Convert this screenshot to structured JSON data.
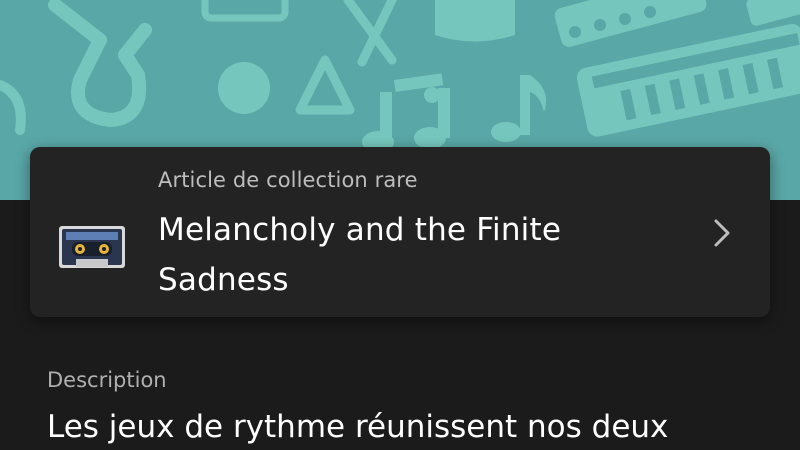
{
  "banner": {
    "pattern": "music-instruments-pattern",
    "color": "#5aa7a7"
  },
  "item_card": {
    "category": "Article de collection rare",
    "title": "Melancholy and the Finite Sadness",
    "thumbnail_icon": "cassette-tape-icon",
    "chevron_icon": "chevron-right-icon"
  },
  "description": {
    "label": "Description",
    "text": "Les jeux de rythme réunissent nos deux"
  }
}
